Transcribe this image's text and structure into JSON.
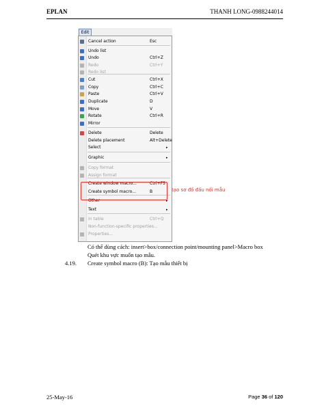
{
  "header": {
    "left": "EPLAN",
    "right": "THANH LONG-0988244014"
  },
  "menu": {
    "tab_label": "Edit",
    "items": [
      {
        "label": "Cancel action",
        "shortcut": "Esc",
        "icon": "arrow-cursor-icon",
        "icon_color": "#5a6f8f",
        "disabled": false,
        "submenu": false
      },
      {
        "label": "Undo list",
        "shortcut": "",
        "icon": "undo-list-icon",
        "icon_color": "#3b6ec4",
        "disabled": false,
        "submenu": false
      },
      {
        "label": "Undo",
        "shortcut": "Ctrl+Z",
        "icon": "undo-icon",
        "icon_color": "#3b6ec4",
        "disabled": false,
        "submenu": false
      },
      {
        "label": "Redo",
        "shortcut": "Ctrl+Y",
        "icon": "redo-icon",
        "icon_color": "#b4b4b4",
        "disabled": true,
        "submenu": false
      },
      {
        "label": "Redo list",
        "shortcut": "",
        "icon": "redo-list-icon",
        "icon_color": "#b4b4b4",
        "disabled": true,
        "submenu": false
      },
      {
        "label": "Cut",
        "shortcut": "Ctrl+X",
        "icon": "scissors-icon",
        "icon_color": "#4a7fc9",
        "disabled": false,
        "submenu": false
      },
      {
        "label": "Copy",
        "shortcut": "Ctrl+C",
        "icon": "copy-icon",
        "icon_color": "#7f9fc9",
        "disabled": false,
        "submenu": false
      },
      {
        "label": "Paste",
        "shortcut": "Ctrl+V",
        "icon": "paste-icon",
        "icon_color": "#c9a24a",
        "disabled": false,
        "submenu": false
      },
      {
        "label": "Duplicate",
        "shortcut": "D",
        "icon": "duplicate-icon",
        "icon_color": "#3b6ec4",
        "disabled": false,
        "submenu": false
      },
      {
        "label": "Move",
        "shortcut": "V",
        "icon": "move-icon",
        "icon_color": "#3b6ec4",
        "disabled": false,
        "submenu": false
      },
      {
        "label": "Rotate",
        "shortcut": "Ctrl+R",
        "icon": "rotate-icon",
        "icon_color": "#3fa34d",
        "disabled": false,
        "submenu": false
      },
      {
        "label": "Mirror",
        "shortcut": "",
        "icon": "mirror-icon",
        "icon_color": "#3b6ec4",
        "disabled": false,
        "submenu": false
      },
      {
        "label": "Delete",
        "shortcut": "Delete",
        "icon": "delete-icon",
        "icon_color": "#d64545",
        "disabled": false,
        "submenu": false
      },
      {
        "label": "Delete placement",
        "shortcut": "Alt+Delete",
        "icon": "",
        "icon_color": "",
        "disabled": false,
        "submenu": false
      },
      {
        "label": "Select",
        "shortcut": "",
        "icon": "",
        "icon_color": "",
        "disabled": false,
        "submenu": true
      },
      {
        "label": "Graphic",
        "shortcut": "",
        "icon": "",
        "icon_color": "",
        "disabled": false,
        "submenu": true
      },
      {
        "label": "Copy format",
        "shortcut": "",
        "icon": "copy-format-icon",
        "icon_color": "#b4b4b4",
        "disabled": true,
        "submenu": false
      },
      {
        "label": "Assign format",
        "shortcut": "",
        "icon": "assign-format-icon",
        "icon_color": "#b4b4b4",
        "disabled": true,
        "submenu": false
      },
      {
        "label": "Create window macro...",
        "shortcut": "Ctrl+F5",
        "icon": "",
        "icon_color": "",
        "disabled": false,
        "submenu": false
      },
      {
        "label": "Create symbol macro...",
        "shortcut": "B",
        "icon": "",
        "icon_color": "",
        "disabled": false,
        "submenu": false
      },
      {
        "label": "Other",
        "shortcut": "",
        "icon": "",
        "icon_color": "",
        "disabled": false,
        "submenu": true
      },
      {
        "label": "Text",
        "shortcut": "",
        "icon": "",
        "icon_color": "",
        "disabled": false,
        "submenu": true
      },
      {
        "label": "In table",
        "shortcut": "Ctrl+Q",
        "icon": "in-table-icon",
        "icon_color": "#b4b4b4",
        "disabled": true,
        "submenu": false
      },
      {
        "label": "Non-function-specific properties...",
        "shortcut": "",
        "icon": "",
        "icon_color": "",
        "disabled": true,
        "submenu": false
      },
      {
        "label": "Properties...",
        "shortcut": "",
        "icon": "properties-icon",
        "icon_color": "#b4b4b4",
        "disabled": true,
        "submenu": false
      }
    ],
    "submenu_arrow": "▸"
  },
  "annotation": "tạo sơ đồ đấu nối mẫu",
  "body": {
    "line1": "Có thể dùng cách: insert>box/connection point/mounting panel>Macro box",
    "line2": "Quét khu vực muốn tạo mẫu.",
    "section_number": "4.19.",
    "section_text": "Create symbol macro   (B): Tạo mẫu thiết bị"
  },
  "footer": {
    "date": "25-May-16",
    "page_word": "Page",
    "page_current": "36",
    "page_of": "of",
    "page_total": "120"
  }
}
